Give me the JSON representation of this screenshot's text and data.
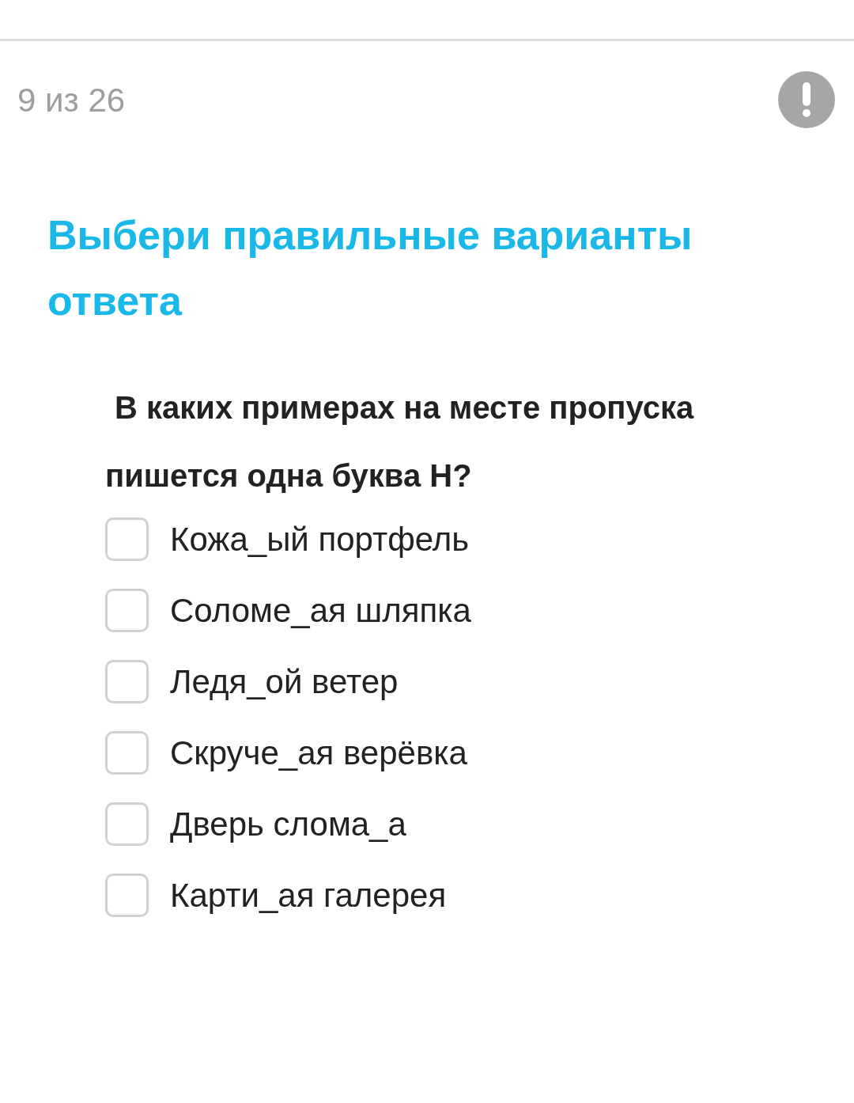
{
  "progress": "9 из 26",
  "title": "Выбери правильные варианты ответа",
  "question": "В каких примерах на месте пропуска пишется одна буква Н?",
  "options": [
    {
      "label": "Кожа_ый портфель",
      "checked": false
    },
    {
      "label": "Соломе_ая шляпка",
      "checked": false
    },
    {
      "label": "Ледя_ой ветер",
      "checked": false
    },
    {
      "label": "Скруче_ая верёвка",
      "checked": false
    },
    {
      "label": "Дверь слома_а",
      "checked": false
    },
    {
      "label": "Карти_ая галерея",
      "checked": false
    }
  ]
}
